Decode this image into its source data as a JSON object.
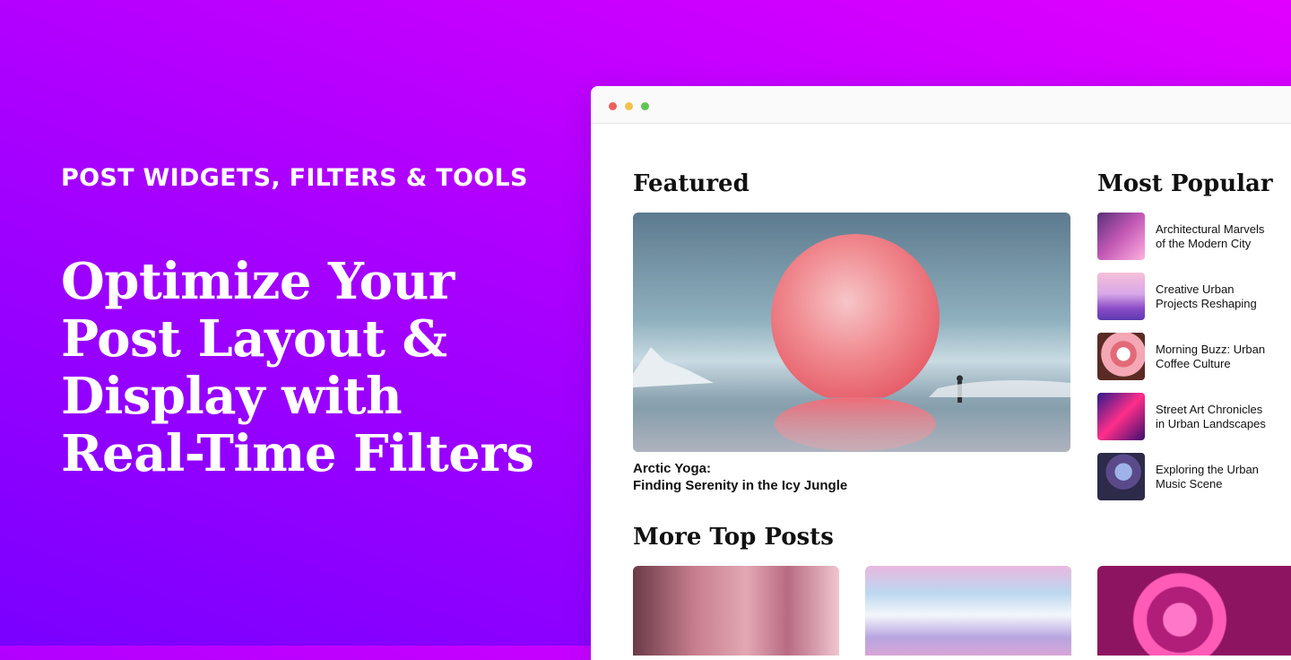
{
  "hero": {
    "eyebrow": "POST WIDGETS, FILTERS & TOOLS",
    "title_lines": [
      "Optimize Your",
      "Post Layout &",
      "Display with",
      "Real-Time Filters"
    ]
  },
  "browser": {
    "featured": {
      "heading": "Featured",
      "caption_lines": [
        "Arctic Yoga:",
        "Finding Serenity in the Icy Jungle"
      ]
    },
    "popular": {
      "heading": "Most Popular",
      "items": [
        {
          "lines": [
            "Architectural Marvels",
            "of the Modern City"
          ]
        },
        {
          "lines": [
            "Creative Urban",
            "Projects Reshaping"
          ]
        },
        {
          "lines": [
            "Morning Buzz: Urban",
            "Coffee Culture"
          ]
        },
        {
          "lines": [
            "Street Art Chronicles",
            "in Urban Landscapes"
          ]
        },
        {
          "lines": [
            "Exploring the Urban",
            "Music Scene"
          ]
        }
      ]
    },
    "more": {
      "heading": "More Top Posts"
    }
  },
  "colors": {
    "gradient_start": "#7a00ff",
    "gradient_end": "#e100ff",
    "window_red": "#ec5f5b",
    "window_yellow": "#f3c24a",
    "window_green": "#61c554"
  }
}
